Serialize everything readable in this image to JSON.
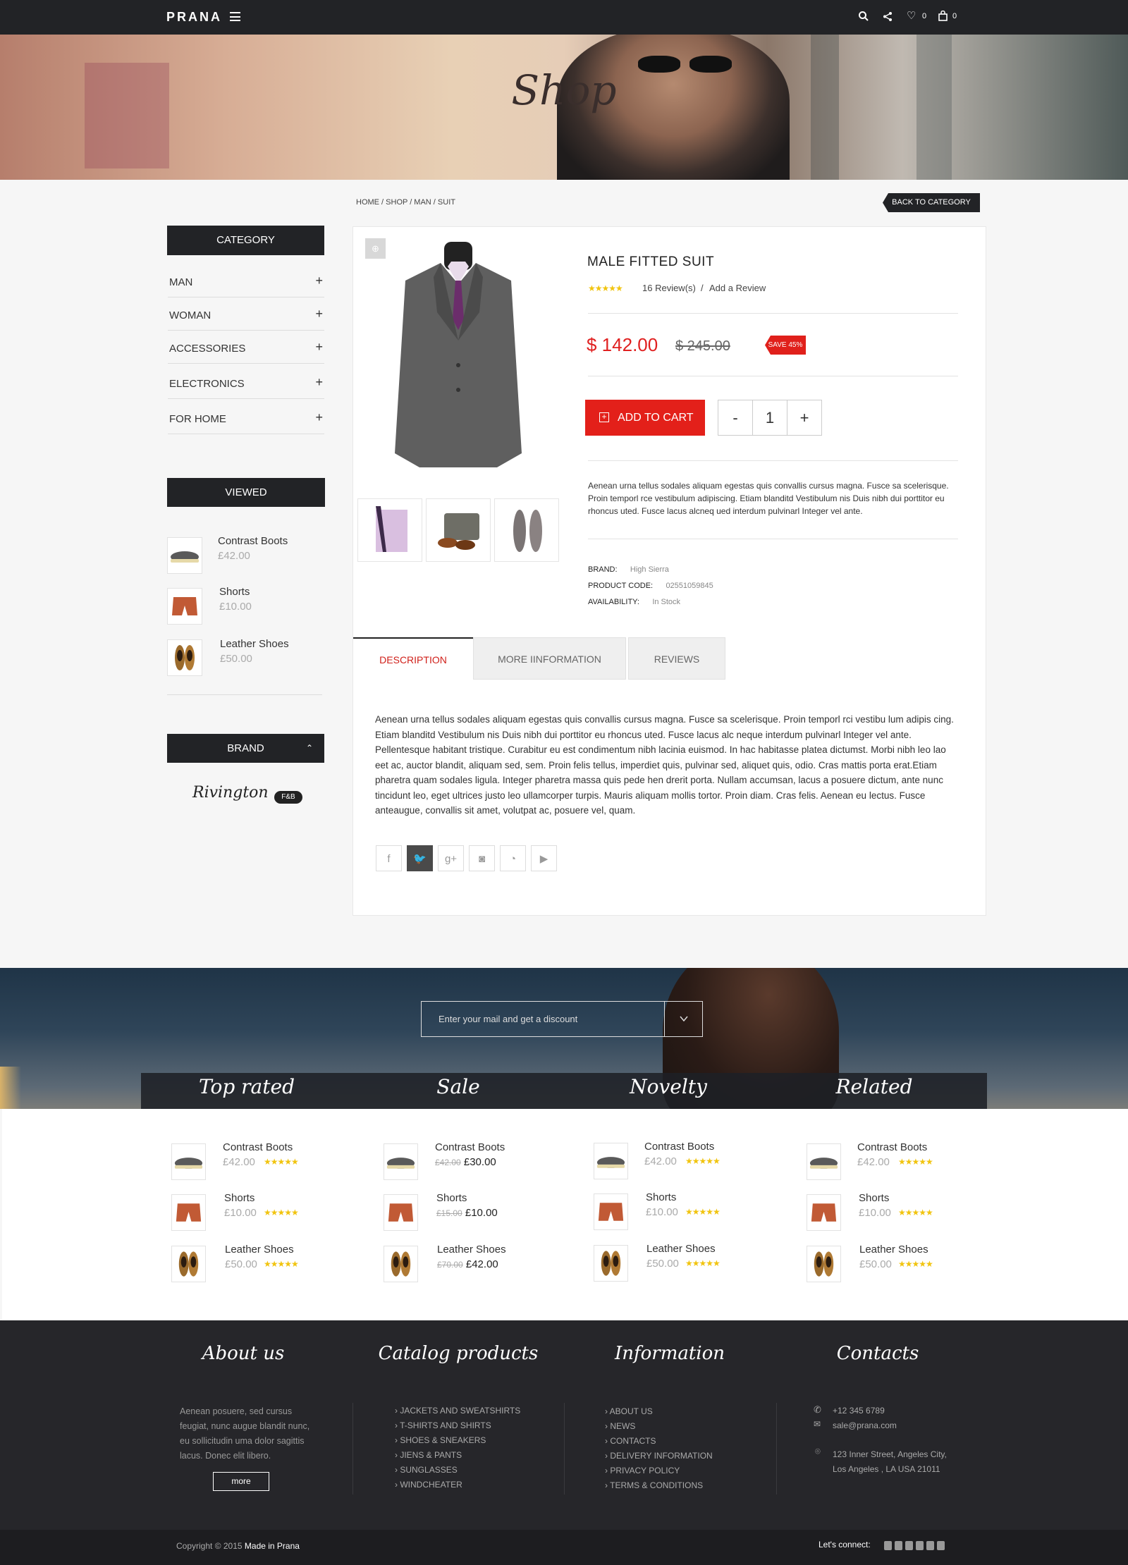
{
  "header": {
    "logo": "PRANA",
    "wishlist_count": "0",
    "cart_count": "0"
  },
  "hero": {
    "title": "Shop"
  },
  "breadcrumb": {
    "text": "HOME / SHOP / MAN / SUIT",
    "back_label": "BACK TO CATEGORY"
  },
  "sidebar": {
    "category_title": "CATEGORY",
    "categories": [
      "MAN",
      "WOMAN",
      "ACCESSORIES",
      "ELECTRONICS",
      "FOR HOME"
    ],
    "viewed_title": "VIEWED",
    "viewed": [
      {
        "name": "Contrast Boots",
        "price": "£42.00"
      },
      {
        "name": "Shorts",
        "price": "£10.00"
      },
      {
        "name": "Leather Shoes",
        "price": "£50.00"
      }
    ],
    "brand_title": "BRAND",
    "brand_logo": "Rivington",
    "brand_badge": "F&B"
  },
  "product": {
    "title": "MALE FITTED SUIT",
    "reviews": "16 Review(s)",
    "add_review": "Add a Review",
    "price": "$ 142.00",
    "old_price": "$ 245.00",
    "save": "SAVE 45%",
    "add_to_cart": "ADD TO CART",
    "minus": "-",
    "qty": "1",
    "plus": "+",
    "short_desc": "Aenean urna tellus sodales aliquam egestas quis convallis cursus magna. Fusce sa scelerisque. Proin temporl rce vestibulum adipiscing. Etiam blanditd Vestibulum nis Duis nibh dui porttitor eu rhoncus uted. Fusce lacus alcneq ued interdum pulvinarl Integer vel ante.",
    "brand_label": "BRAND:",
    "brand": "High Sierra",
    "code_label": "PRODUCT CODE:",
    "code": "02551059845",
    "avail_label": "AVAILABILITY:",
    "avail": "In Stock",
    "tabs": [
      "DESCRIPTION",
      "MORE IINFORMATION",
      "REVIEWS"
    ],
    "long_desc": "Aenean urna tellus sodales aliquam egestas quis convallis cursus magna. Fusce sa scelerisque. Proin temporl rci vestibu lum adipis cing. Etiam blanditd Vestibulum nis Duis nibh dui porttitor eu rhoncus uted. Fusce lacus alc neque interdum pulvinarl Integer vel ante. Pellentesque habitant tristique. Curabitur eu est condimentum nibh lacinia euismod. In hac habitasse platea dictumst. Morbi nibh leo lao eet ac, auctor blandit, aliquam sed, sem. Proin felis tellus, imperdiet quis, pulvinar sed, aliquet quis, odio. Cras mattis porta erat.Etiam pharetra quam sodales ligula. Integer pharetra massa quis pede hen drerit porta. Nullam accumsan, lacus a posuere dictum, ante nunc tincidunt leo, eget ultrices justo leo ullamcorper turpis. Mauris aliquam mollis tortor. Proin diam. Cras felis. Aenean eu lectus. Fusce anteaugue, convallis sit amet, volutpat ac, posuere vel, quam."
  },
  "newsletter": {
    "placeholder": "Enter your mail and get a discount"
  },
  "lists": [
    {
      "title": "Top rated",
      "items": [
        {
          "name": "Contrast Boots",
          "price": "£42.00"
        },
        {
          "name": "Shorts",
          "price": "£10.00"
        },
        {
          "name": "Leather Shoes",
          "price": "£50.00"
        }
      ]
    },
    {
      "title": "Sale",
      "items": [
        {
          "name": "Contrast Boots",
          "old": "£42.00",
          "price": "£30.00"
        },
        {
          "name": "Shorts",
          "old": "£15.00",
          "price": "£10.00"
        },
        {
          "name": "Leather Shoes",
          "old": "£70.00",
          "price": "£42.00"
        }
      ]
    },
    {
      "title": "Novelty",
      "items": [
        {
          "name": "Contrast Boots",
          "price": "£42.00"
        },
        {
          "name": "Shorts",
          "price": "£10.00"
        },
        {
          "name": "Leather Shoes",
          "price": "£50.00"
        }
      ]
    },
    {
      "title": "Related",
      "items": [
        {
          "name": "Contrast Boots",
          "price": "£42.00"
        },
        {
          "name": "Shorts",
          "price": "£10.00"
        },
        {
          "name": "Leather Shoes",
          "price": "£50.00"
        }
      ]
    }
  ],
  "footer": {
    "about_title": "About us",
    "about_text": "Aenean posuere, sed cursus feugiat, nunc augue blandit nunc, eu sollicitudin uma dolor sagittis lacus. Donec elit libero.",
    "more": "more",
    "catalog_title": "Catalog products",
    "catalog": [
      "JACKETS AND SWEATSHIRTS",
      "T-SHIRTS AND SHIRTS",
      "SHOES & SNEAKERS",
      "JIENS & PANTS",
      "SUNGLASSES",
      "WINDCHEATER"
    ],
    "info_title": "Information",
    "info": [
      "ABOUT US",
      "NEWS",
      "CONTACTS",
      "DELIVERY INFORMATION",
      "PRIVACY POLICY",
      "TERMS & CONDITIONS"
    ],
    "contacts_title": "Contacts",
    "phone": "+12 345 6789",
    "email": "sale@prana.com",
    "address1": "123 Inner Street, Angeles City,",
    "address2": "Los Angeles , LA USA 21011"
  },
  "bottom": {
    "copyright": "Copyright © 2015",
    "made": "Made in Prana",
    "connect": "Let's connect:"
  },
  "colors": {
    "accent": "#e3201a",
    "dark": "#222326",
    "star": "#f1c40f"
  }
}
